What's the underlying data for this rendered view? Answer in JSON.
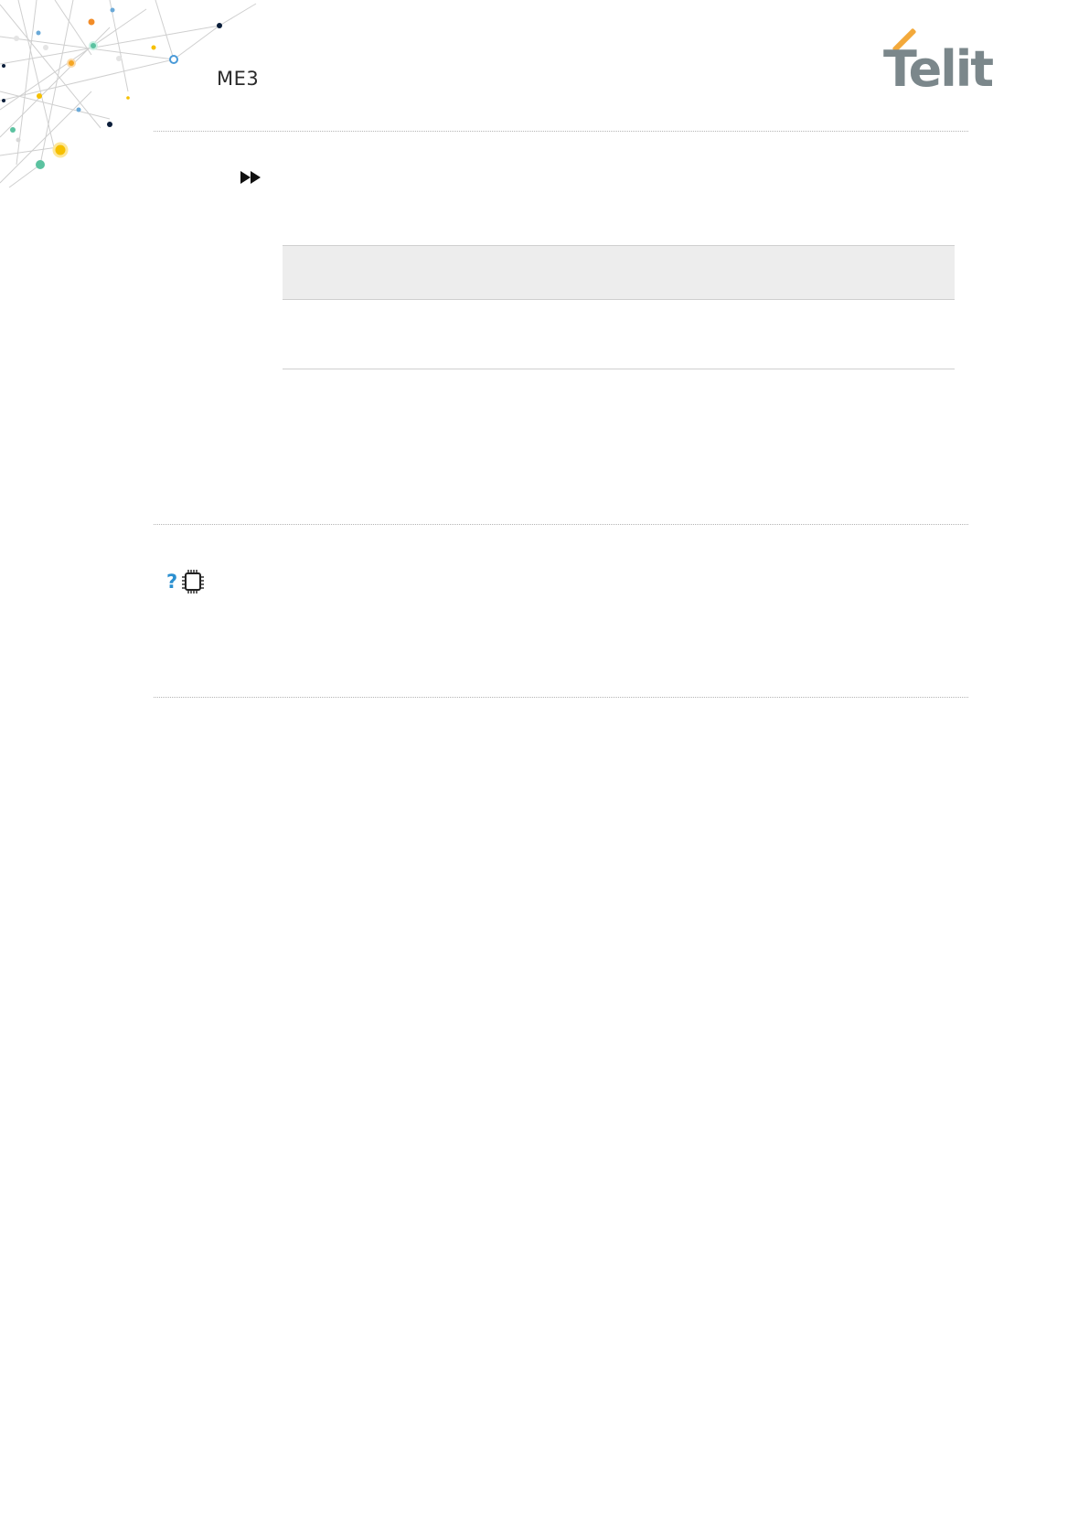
{
  "header": {
    "doc_code": "ME3",
    "logo_text": "Telit",
    "colors": {
      "logo_gray": "#7b878b",
      "logo_accent": "#f3a93b",
      "qmark_blue": "#2a8fd0"
    }
  },
  "icons": {
    "corner": "network-graph-decoration",
    "arrow": "fast-forward-icon",
    "note_question": "question-mark-icon",
    "note_chip": "chip-icon"
  },
  "table": {
    "header_cells": [],
    "rows": []
  }
}
